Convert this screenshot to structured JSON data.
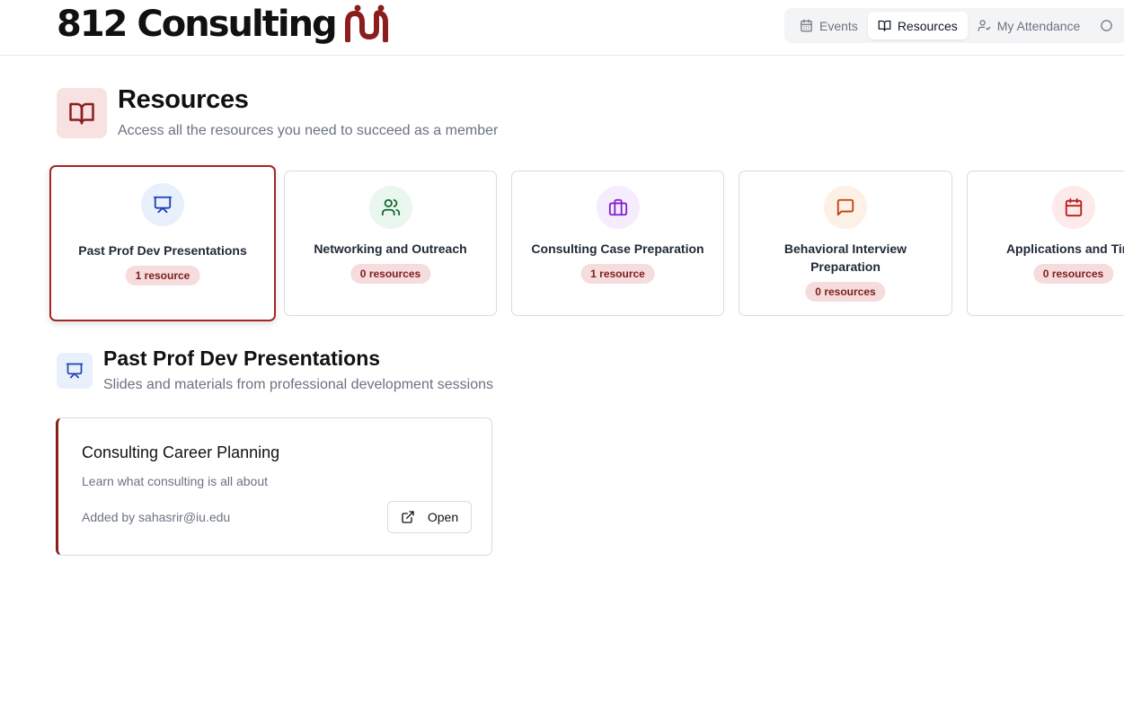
{
  "brand": {
    "name": "812 Consulting",
    "accent": "#8b1d1d"
  },
  "nav": {
    "items": [
      {
        "label": "Events",
        "icon": "calendar-icon",
        "active": false
      },
      {
        "label": "Resources",
        "icon": "book-open-icon",
        "active": true
      },
      {
        "label": "My Attendance",
        "icon": "user-check-icon",
        "active": false
      }
    ]
  },
  "page": {
    "title": "Resources",
    "subtitle": "Access all the resources you need to succeed as a member",
    "icon": "book-open-icon"
  },
  "categories": [
    {
      "title": "Past Prof Dev Presentations",
      "count": "1 resource",
      "icon": "presentation-icon",
      "color": "#1e40af",
      "bg": "#e8f0fc",
      "selected": true
    },
    {
      "title": "Networking and Outreach",
      "count": "0 resources",
      "icon": "users-icon",
      "color": "#166534",
      "bg": "#e9f7ee",
      "selected": false
    },
    {
      "title": "Consulting Case Preparation",
      "count": "1 resource",
      "icon": "briefcase-icon",
      "color": "#7e22ce",
      "bg": "#f5ecfd",
      "selected": false
    },
    {
      "title": "Behavioral Interview Preparation",
      "count": "0 resources",
      "icon": "message-square-icon",
      "color": "#c2410c",
      "bg": "#fdf0e6",
      "selected": false
    },
    {
      "title": "Applications and Time",
      "count": "0 resources",
      "icon": "calendar-icon",
      "color": "#b91c1c",
      "bg": "#fdeaea",
      "selected": false
    }
  ],
  "section": {
    "title": "Past Prof Dev Presentations",
    "subtitle": "Slides and materials from professional development sessions",
    "icon": "presentation-icon"
  },
  "resources": [
    {
      "title": "Consulting Career Planning",
      "description": "Learn what consulting is all about",
      "added_by": "Added by sahasrir@iu.edu",
      "action_label": "Open"
    }
  ]
}
